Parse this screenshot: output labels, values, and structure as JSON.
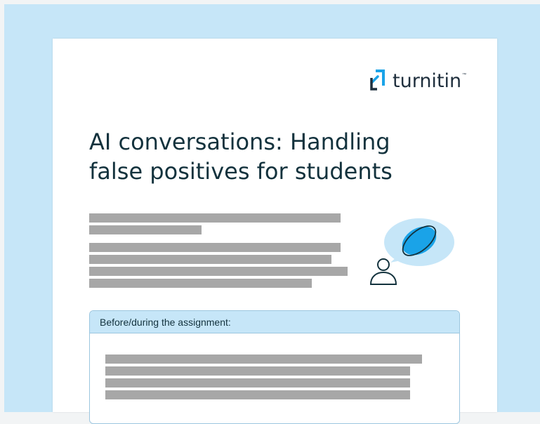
{
  "brand": {
    "name": "turnitin",
    "trademark": "™",
    "accent_color": "#1aa3e8",
    "text_color": "#1f2f3d"
  },
  "title": {
    "line1": "AI conversations: Handling",
    "line2": "false positives for students"
  },
  "section": {
    "header": "Before/during the assignment:"
  },
  "illustration": {
    "person_icon": "person-icon",
    "bubble_icon": "speech-bubble-icon",
    "ai_icon": "ai-orbit-icon"
  },
  "colors": {
    "background": "#c6e6f8",
    "placeholder_bar": "#a7a7a7",
    "section_header_bg": "#c6e6f8"
  }
}
